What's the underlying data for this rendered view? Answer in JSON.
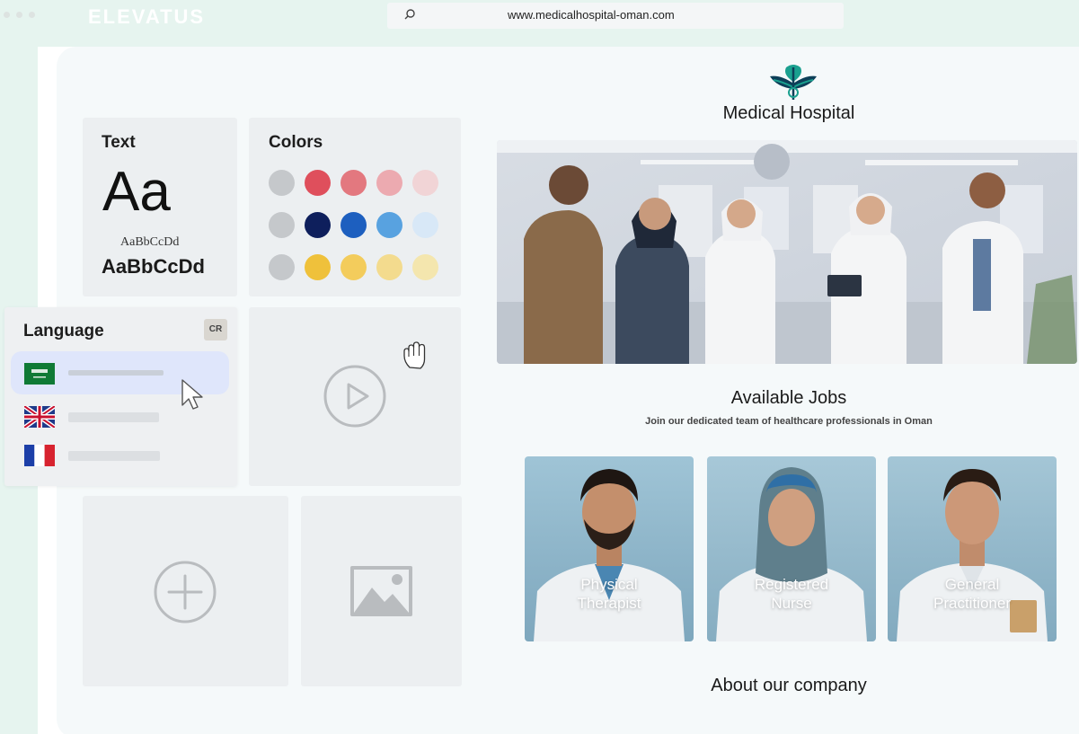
{
  "window": {
    "brand": "ELEVATUS",
    "url": "www.medicalhospital-oman.com"
  },
  "editor": {
    "text_card": {
      "title": "Text",
      "big_sample": "Aa",
      "serif_sample": "AaBbCcDd",
      "bold_sample": "AaBbCcDd"
    },
    "colors_card": {
      "title": "Colors",
      "swatches": [
        "#c5c8cb",
        "#df4f5c",
        "#e3787f",
        "#ecaab0",
        "#f1d4d6",
        "#c5c8cb",
        "#0e1f5c",
        "#1d5fbf",
        "#58a2e0",
        "#d8e8f7",
        "#c5c8cb",
        "#efc13b",
        "#f3cc5c",
        "#f3db8e",
        "#f4e6ae"
      ]
    },
    "language_card": {
      "title": "Language",
      "badge": "CR",
      "languages": [
        "arabic-flag",
        "uk-flag",
        "france-flag"
      ]
    }
  },
  "site": {
    "name": "Medical Hospital",
    "jobs_title": "Available Jobs",
    "jobs_subtitle": "Join our dedicated team of healthcare professionals in Oman",
    "jobs": [
      {
        "title_line1": "Physical",
        "title_line2": "Therapist"
      },
      {
        "title_line1": "Registered",
        "title_line2": "Nurse"
      },
      {
        "title_line1": "General",
        "title_line2": "Practitioner"
      }
    ],
    "about_title": "About our company"
  },
  "colors": {
    "accent_mint": "#e6f4ef",
    "selection_blue": "#dfe6fb",
    "logo_teal": "#1aa08f"
  }
}
